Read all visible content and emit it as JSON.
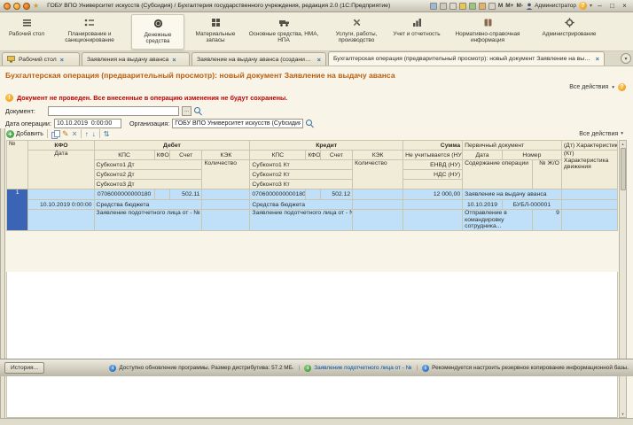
{
  "titlebar": {
    "title": "ГОБУ ВПО Университет искусств (Субсидия) / Бухгалтерия государственного учреждения, редакция 2.0 (1С:Предприятие)",
    "memory": [
      "M",
      "M+",
      "M-"
    ],
    "user": "Администратор"
  },
  "ribbon": {
    "sections": [
      {
        "label": "Рабочий стол"
      },
      {
        "label": "Планирование и санкционирование"
      },
      {
        "label": "Денежные средства"
      },
      {
        "label": "Материальные запасы"
      },
      {
        "label": "Основные средства, НМА, НПА"
      },
      {
        "label": "Услуги, работы, производство"
      },
      {
        "label": "Учет и отчетность"
      },
      {
        "label": "Нормативно-справочная информация"
      },
      {
        "label": "Администрирование"
      }
    ]
  },
  "tabs": [
    {
      "label": "Рабочий стол"
    },
    {
      "label": "Заявления на выдачу аванса"
    },
    {
      "label": "Заявление на выдачу аванса (создание) *"
    },
    {
      "label": "Бухгалтерская операция (предварительный просмотр): новый документ Заявление на выдачу аванса"
    }
  ],
  "form": {
    "title": "Бухгалтерская операция (предварительный просмотр): новый документ Заявление на выдачу аванса",
    "all_actions": "Все действия",
    "warning": "Документ не проведен. Все внесенные в операцию изменения не будут сохранены.",
    "fields": {
      "document_label": "Документ:",
      "document_value": "",
      "date_label": "Дата операции:",
      "date_value": "10.10.2019  0:00:00",
      "org_label": "Организация:",
      "org_value": "ГОБУ ВПО Университет искусств (Субсидия)"
    },
    "toolbar": {
      "add_label": "Добавить",
      "all_actions": "Все действия"
    }
  },
  "table": {
    "headers": {
      "num": "№",
      "kfo": "КФО",
      "date": "Дата",
      "debit": "Дебет",
      "credit": "Кредит",
      "kps": "КПС",
      "kfo2": "КФО",
      "account": "Счет",
      "kek": "КЭК",
      "qty": "Количество",
      "qty2": "Количество",
      "debit_sub1": "Субконто1 Дт",
      "debit_sub2": "Субконто2 Дт",
      "debit_sub3": "Субконто3 Дт",
      "credit_sub1": "Субконто1 Кт",
      "credit_sub2": "Субконто2 Кт",
      "credit_sub3": "Субконто3 Кт",
      "sum": "Сумма",
      "sum_nu": "Не учитывается (НУ)",
      "sum_envd": "ЕНВД (НУ)",
      "sum_nds": "НДС (НУ)",
      "primary": "Первичный документ",
      "primary_date": "Дата",
      "primary_number": "Номер",
      "operation": "Содержание операции",
      "journal": "№ Ж/О",
      "char_dt": "(Дт) Характеристика ...",
      "char_kt": "(Кт) Характеристика движения"
    },
    "row": {
      "num": "1",
      "date": "10.10.2019 0:00:00",
      "debit_kps": "0706000000000180",
      "debit_account": "502.11",
      "debit_sub1": "Средства бюджета",
      "debit_sub2": "Заявление подотчетного лица от - №",
      "credit_kps": "0706000000000180",
      "credit_account": "502.12",
      "credit_sub1": "Средства бюджета",
      "credit_sub2": "Заявление подотчетного лица от - №",
      "sum": "12 000,00",
      "primary_doc": "Заявление на выдачу аванса",
      "primary_date": "10.10.2019",
      "primary_number": "БУБЛ-000001",
      "operation": "Отправление в командировку сотрудника...",
      "journal": "9"
    }
  },
  "statusbar": {
    "history_label": "История...",
    "update_message": "Доступно обновление программы. Размер дистрибутива: 57.2 МБ.",
    "link_message": "Заявление подотчетного лица от - №",
    "backup_message": "Рекомендуется настроить резервное копирование информационной базы."
  },
  "icons": {
    "close": "×",
    "dropdown": "▾",
    "help": "?",
    "warning": "!",
    "info": "i",
    "add": "+",
    "ellipsis": "...",
    "pencil": "✎",
    "delete": "×",
    "up": "↑",
    "down": "↓",
    "reorder": "⇅",
    "minimize": "–",
    "restore": "□",
    "close_win": "×",
    "star": "★",
    "uparr": "▴",
    "downarr": "▾"
  }
}
